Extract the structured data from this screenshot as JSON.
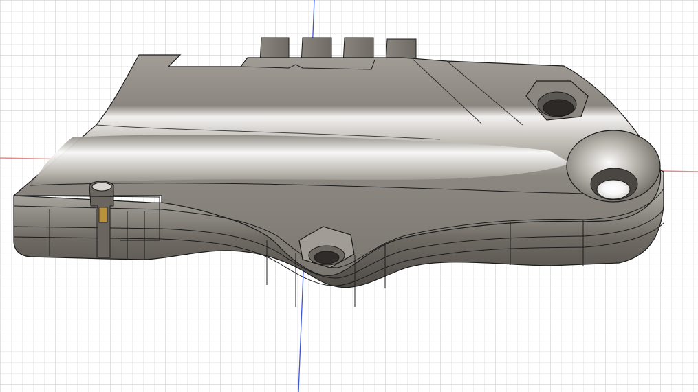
{
  "viewport": {
    "background_color": "#ffffff",
    "grid_minor_color": "#e2e2e2",
    "grid_major_color": "#cfcfcf",
    "axis_x_color": "#e58a8a",
    "axis_y_color": "#3d55d6"
  },
  "model": {
    "body_color": "#7f7a73",
    "top_face_color": "#8f8a83",
    "highlight_color": "#f2f1ef",
    "edge_color": "#1c1c1c",
    "accent_color": "#b9903b",
    "features": {
      "tabs": 4,
      "hex_pockets": 2,
      "countersunk_holes": 1,
      "clip_slot": 1
    }
  }
}
